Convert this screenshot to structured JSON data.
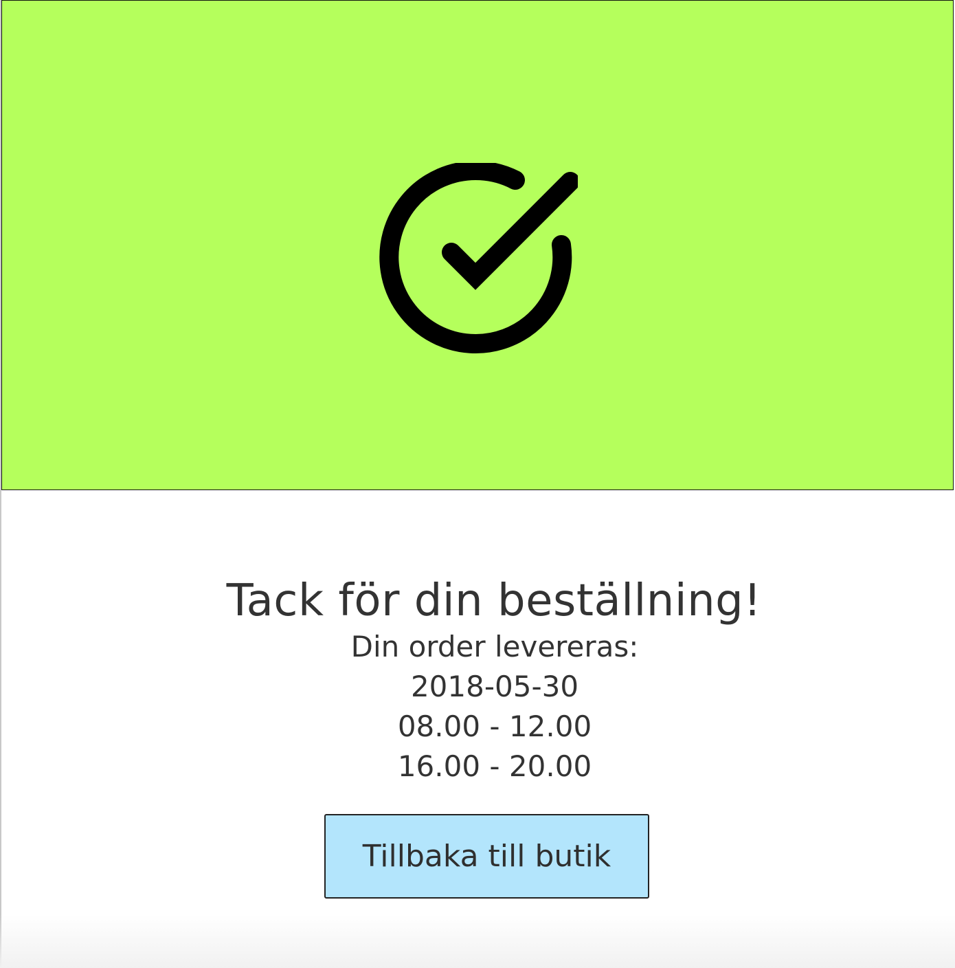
{
  "colors": {
    "hero_background": "#b5ff5c",
    "button_background": "#b3e5fc",
    "text": "#333333"
  },
  "hero": {
    "icon": "check-circle-icon"
  },
  "confirmation": {
    "title": "Tack för din beställning!",
    "delivery_label": "Din order levereras:",
    "delivery_date": "2018-05-30",
    "time_slots": [
      "08.00 - 12.00",
      "16.00 - 20.00"
    ]
  },
  "actions": {
    "back_to_shop_label": "Tillbaka till butik"
  }
}
